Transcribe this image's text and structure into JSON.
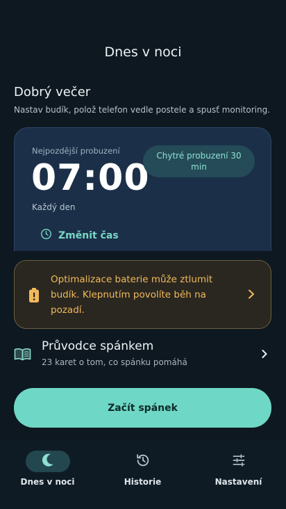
{
  "header": {
    "title": "Dnes v noci"
  },
  "intro": {
    "greeting": "Dobrý večer",
    "subtitle": "Nastav budík, polož telefon vedle postele a spusť monitoring."
  },
  "alarm": {
    "label": "Nejpozdější probuzení",
    "time": "07:00",
    "repeat": "Každý den",
    "smart_wake": "Chytré probuzení 30 min",
    "change_time_label": "Změnit čas"
  },
  "battery_warning": {
    "text": "Optimalizace baterie může ztlumit budík. Klepnutím povolíte běh na pozadí.",
    "accent": "#f2ba5c"
  },
  "sleep_guide": {
    "title": "Průvodce spánkem",
    "subtitle": "23 karet o tom, co spánku pomáhá"
  },
  "start_button": {
    "label": "Začít spánek",
    "color": "#6fd7c6"
  },
  "nav": {
    "items": [
      {
        "label": "Dnes v noci",
        "icon": "moon-icon",
        "active": true
      },
      {
        "label": "Historie",
        "icon": "history-icon",
        "active": false
      },
      {
        "label": "Nastavení",
        "icon": "sliders-icon",
        "active": false
      }
    ]
  }
}
